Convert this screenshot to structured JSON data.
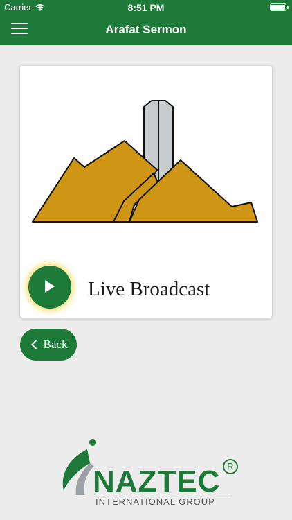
{
  "status_bar": {
    "carrier": "Carrier",
    "time": "8:51 PM"
  },
  "nav": {
    "title": "Arafat Sermon",
    "menu_icon": "hamburger-menu-icon"
  },
  "card": {
    "image_icon": "mount-arafat-illustration",
    "play_icon": "play-icon",
    "label": "Live Broadcast"
  },
  "back_button": {
    "label": "Back",
    "icon": "chevron-left-icon"
  },
  "logo": {
    "name": "NAZTEC",
    "registered": "R",
    "subtitle": "INTERNATIONAL GROUP"
  },
  "colors": {
    "primary_green": "#1d7a38",
    "mountain_gold": "#cf9616",
    "pillar_gray": "#c8cccf",
    "background": "#ececec"
  }
}
